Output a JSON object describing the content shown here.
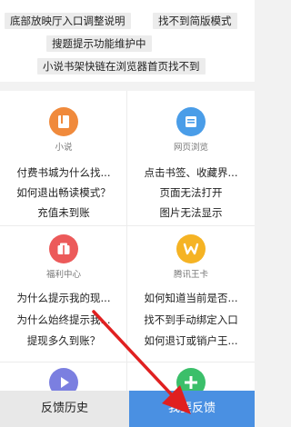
{
  "tags": [
    "底部放映厅入口调整说明",
    "找不到简版模式",
    "搜题提示功能维护中",
    "小说书架快链在浏览器首页找不到"
  ],
  "categories": [
    {
      "label": "小说",
      "icon": "book-icon",
      "color": "#f08a3c",
      "questions": [
        "付费书城为什么找...",
        "如何退出畅读模式？",
        "充值未到账"
      ]
    },
    {
      "label": "网页浏览",
      "icon": "globe-icon",
      "color": "#4a9de8",
      "questions": [
        "点击书签、收藏界...",
        "页面无法打开",
        "图片无法显示"
      ]
    },
    {
      "label": "福利中心",
      "icon": "gift-icon",
      "color": "#ec5a5a",
      "questions": [
        "为什么提示我的现...",
        "为什么始终提示我...",
        "提现多久到账？"
      ]
    },
    {
      "label": "腾讯王卡",
      "icon": "wangka-icon",
      "color": "#f5b324",
      "questions": [
        "如何知道当前是否...",
        "找不到手动绑定入口",
        "如何退订或销户王..."
      ]
    }
  ],
  "partial_icons": [
    {
      "icon": "play-icon",
      "color": "#7b7fe0"
    },
    {
      "icon": "plus-icon",
      "color": "#3bbf6a"
    }
  ],
  "bottom": {
    "history_label": "反馈历史",
    "feedback_label": "我要反馈"
  },
  "colors": {
    "accent": "#4a90e2",
    "arrow": "#e02020"
  }
}
